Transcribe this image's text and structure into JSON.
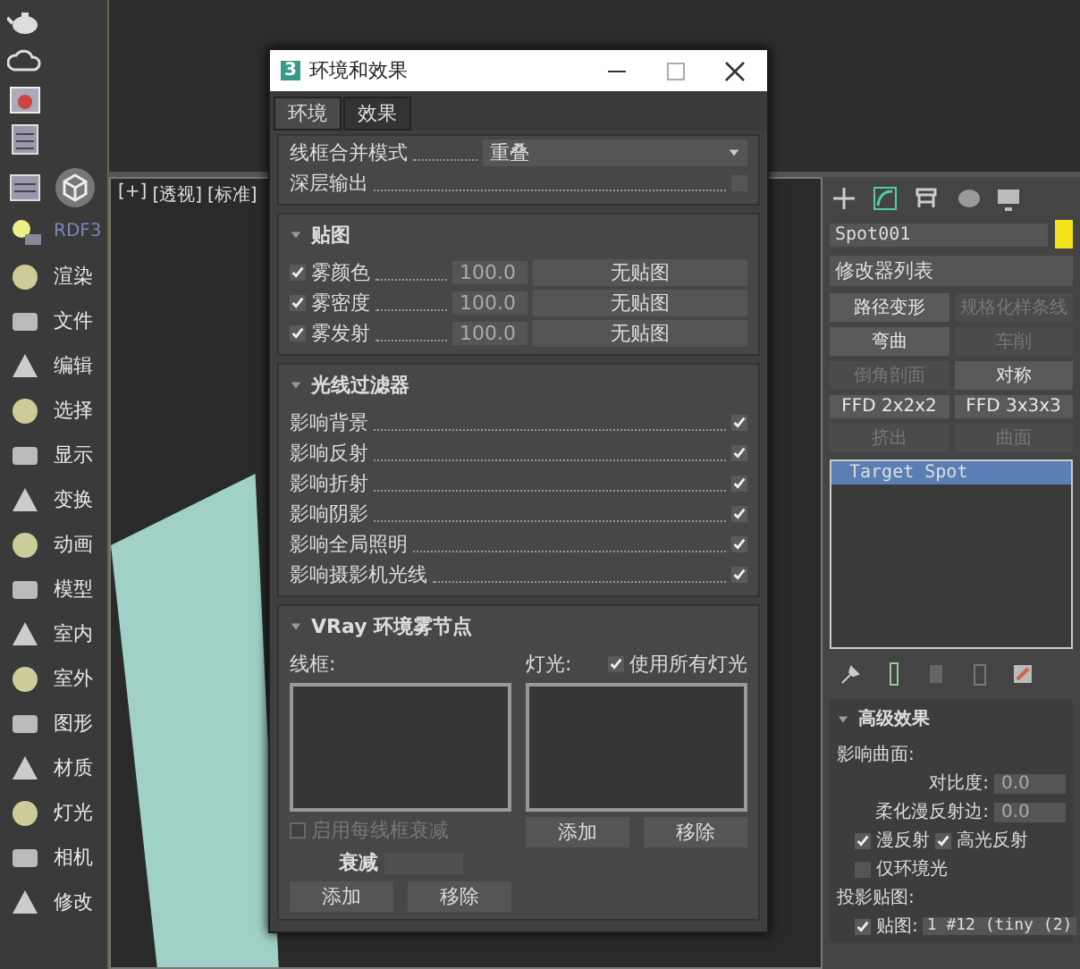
{
  "toolbar": {
    "brand": "RDF3",
    "items": [
      "渲染",
      "文件",
      "编辑",
      "选择",
      "显示",
      "变换",
      "动画",
      "模型",
      "室内",
      "室外",
      "图形",
      "材质",
      "灯光",
      "相机",
      "修改"
    ]
  },
  "viewport": {
    "labels": [
      "[+]",
      "[透视]",
      "[标准]"
    ]
  },
  "dialog": {
    "icon_glyph": "3",
    "title": "环境和效果",
    "tabs": [
      {
        "label": "环境",
        "selected": true
      },
      {
        "label": "效果",
        "selected": false
      }
    ],
    "merge_mode": {
      "label": "线框合并模式",
      "value": "重叠"
    },
    "deep_output": {
      "label": "深层输出",
      "checked": false
    },
    "maps": {
      "title": "贴图",
      "rows": [
        {
          "label": "雾颜色",
          "checked": true,
          "value": "100.0",
          "button": "无贴图"
        },
        {
          "label": "雾密度",
          "checked": true,
          "value": "100.0",
          "button": "无贴图"
        },
        {
          "label": "雾发射",
          "checked": true,
          "value": "100.0",
          "button": "无贴图"
        }
      ]
    },
    "ray_filter": {
      "title": "光线过滤器",
      "rows": [
        {
          "label": "影响背景",
          "checked": true
        },
        {
          "label": "影响反射",
          "checked": true
        },
        {
          "label": "影响折射",
          "checked": true
        },
        {
          "label": "影响阴影",
          "checked": true
        },
        {
          "label": "影响全局照明",
          "checked": true
        },
        {
          "label": "影响摄影机光线",
          "checked": true
        }
      ]
    },
    "vray_fog": {
      "title": "VRay 环境雾节点",
      "wireframe_label": "线框:",
      "lights_label": "灯光:",
      "use_all_lights": {
        "label": "使用所有灯光",
        "checked": true
      },
      "lights_add": "添加",
      "lights_remove": "移除",
      "per_wire_falloff": {
        "label": "启用每线框衰减",
        "checked": false,
        "disabled": true
      },
      "falloff_label": "衰减",
      "wire_add": "添加",
      "wire_remove": "移除"
    }
  },
  "command_panel": {
    "name": "Spot001",
    "color": "#f2e21a",
    "modifier_list": "修改器列表",
    "modifiers": [
      {
        "label": "路径变形",
        "disabled": false
      },
      {
        "label": "规格化样条线",
        "disabled": true
      },
      {
        "label": "弯曲",
        "disabled": false
      },
      {
        "label": "车削",
        "disabled": true
      },
      {
        "label": "倒角剖面",
        "disabled": true
      },
      {
        "label": "对称",
        "disabled": false
      },
      {
        "label": "FFD 2x2x2",
        "disabled": false
      },
      {
        "label": "FFD 3x3x3",
        "disabled": false
      },
      {
        "label": "挤出",
        "disabled": true
      },
      {
        "label": "曲面",
        "disabled": true
      }
    ],
    "stack": [
      {
        "label": "Target Spot",
        "selected": true
      }
    ],
    "advanced": {
      "title": "高级效果",
      "affect_surfaces": "影响曲面:",
      "contrast": {
        "label": "对比度:",
        "value": "0.0"
      },
      "soften": {
        "label": "柔化漫反射边:",
        "value": "0.0"
      },
      "diffuse": {
        "label": "漫反射",
        "checked": true
      },
      "specular": {
        "label": "高光反射",
        "checked": true
      },
      "ambient_only": {
        "label": "仅环境光",
        "checked": false
      },
      "projector_label": "投影贴图:",
      "map": {
        "label": "贴图:",
        "checked": true,
        "value": "1 #12 (tiny (2)"
      }
    }
  }
}
